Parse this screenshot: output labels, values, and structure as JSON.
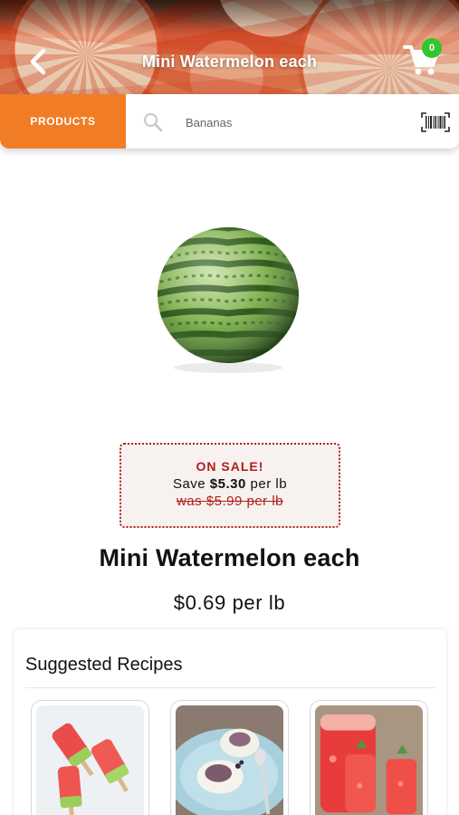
{
  "header": {
    "title": "Mini Watermelon each",
    "cart_count": "0"
  },
  "search": {
    "products_label": "PRODUCTS",
    "placeholder": "Bananas"
  },
  "product": {
    "image_icon": "watermelon-image",
    "sale": {
      "title": "ON SALE!",
      "save_prefix": "Save ",
      "save_amount": "$5.30",
      "save_suffix": " per lb",
      "was_price": "was $5.99 per lb"
    },
    "name": "Mini Watermelon each",
    "price": "$0.69 per lb"
  },
  "recipes": {
    "title": "Suggested Recipes",
    "items": [
      {
        "icon": "popsicles-image"
      },
      {
        "icon": "ice-cream-bowls-image"
      },
      {
        "icon": "watermelon-drink-image"
      }
    ]
  },
  "colors": {
    "accent_orange": "#f07d26",
    "sale_red": "#b0201a",
    "badge_green": "#33c52e"
  }
}
